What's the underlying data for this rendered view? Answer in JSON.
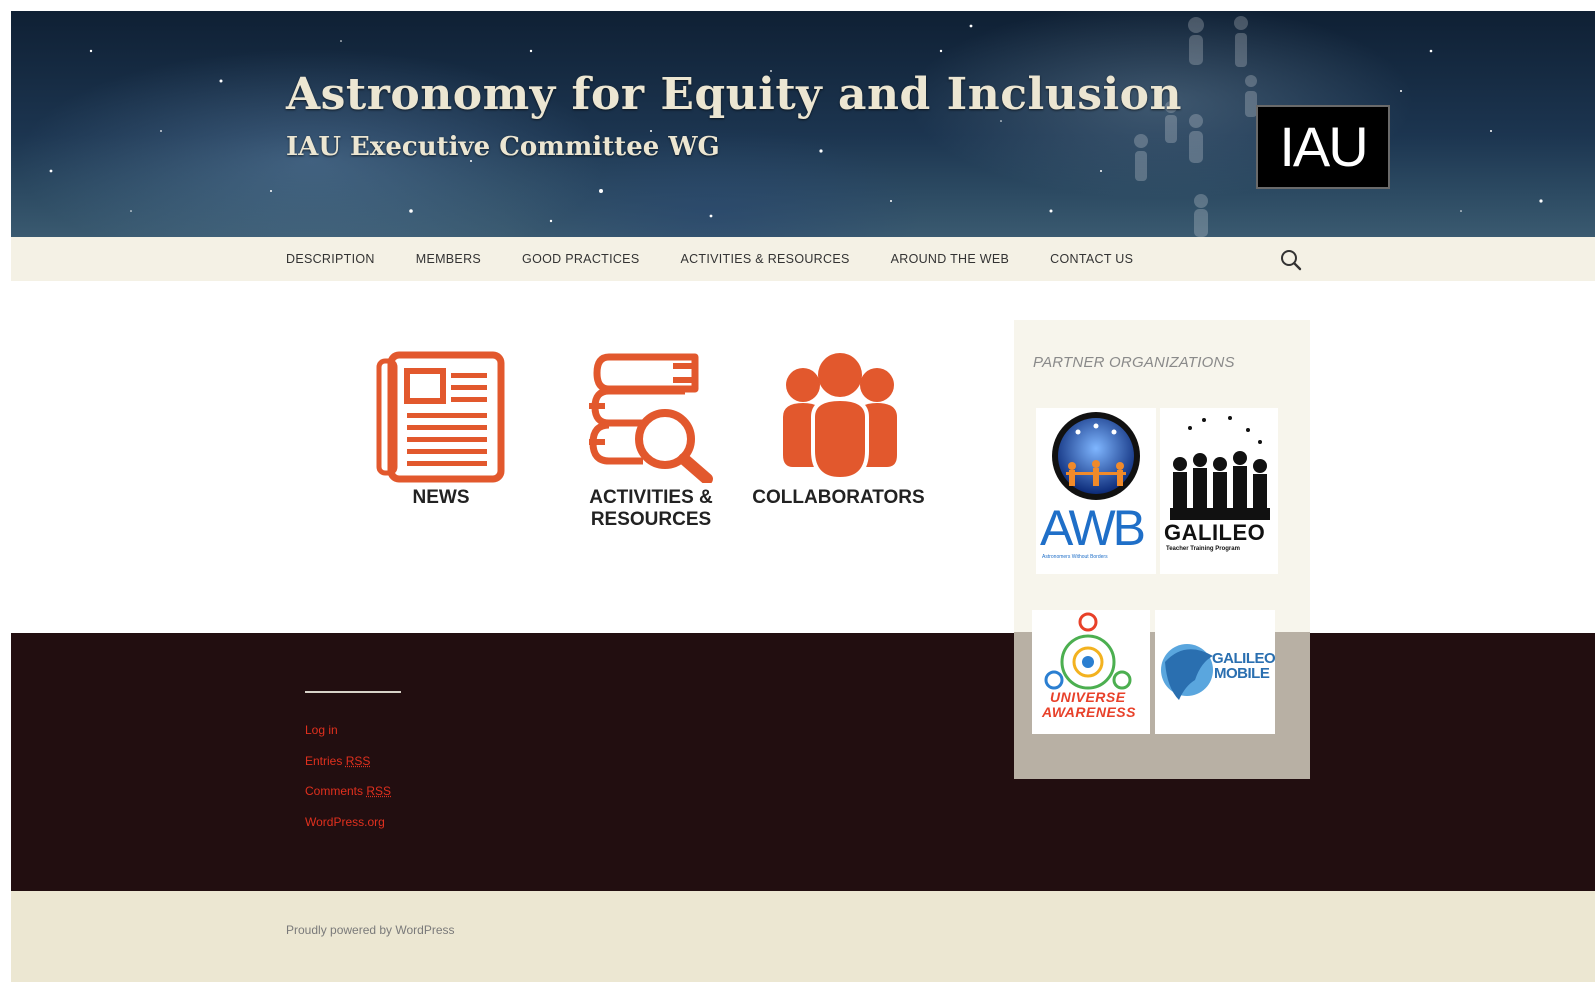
{
  "header": {
    "site_title": "Astronomy for Equity and Inclusion",
    "site_description": "IAU Executive Committee WG",
    "logo_text": "IAU"
  },
  "nav": {
    "items": [
      {
        "label": "DESCRIPTION"
      },
      {
        "label": "MEMBERS"
      },
      {
        "label": "GOOD PRACTICES"
      },
      {
        "label": "ACTIVITIES & RESOURCES"
      },
      {
        "label": "AROUND THE WEB"
      },
      {
        "label": "CONTACT US"
      }
    ],
    "search_icon": "search-icon"
  },
  "features": [
    {
      "label": "NEWS",
      "icon": "newspaper-icon"
    },
    {
      "label_line1": "ACTIVITIES &",
      "label_line2": "RESOURCES",
      "icon": "books-magnifier-icon"
    },
    {
      "label": "COLLABORATORS",
      "icon": "people-group-icon"
    }
  ],
  "sidebar": {
    "heading": "PARTNER ORGANIZATIONS",
    "partners": [
      {
        "name": "AWB",
        "subtitle": "Astronomers Without Borders"
      },
      {
        "name": "GALILEO",
        "subtitle": "Teacher Training Program"
      },
      {
        "name_line1": "UNIVERSE",
        "name_line2": "AWARENESS"
      },
      {
        "name_line1": "GALILEO",
        "name_line2": "MOBILE"
      }
    ]
  },
  "footer": {
    "meta_links": [
      {
        "text": "Log in"
      },
      {
        "text": "Entries ",
        "abbr": "RSS"
      },
      {
        "text": "Comments ",
        "abbr": "RSS"
      },
      {
        "text": "WordPress.org"
      }
    ],
    "powered_by": "Proudly powered by WordPress"
  },
  "colors": {
    "accent_orange": "#e2582d",
    "footer_dark": "#220e10",
    "nav_bg": "#f4f1e5",
    "link_red": "#e0301e"
  }
}
